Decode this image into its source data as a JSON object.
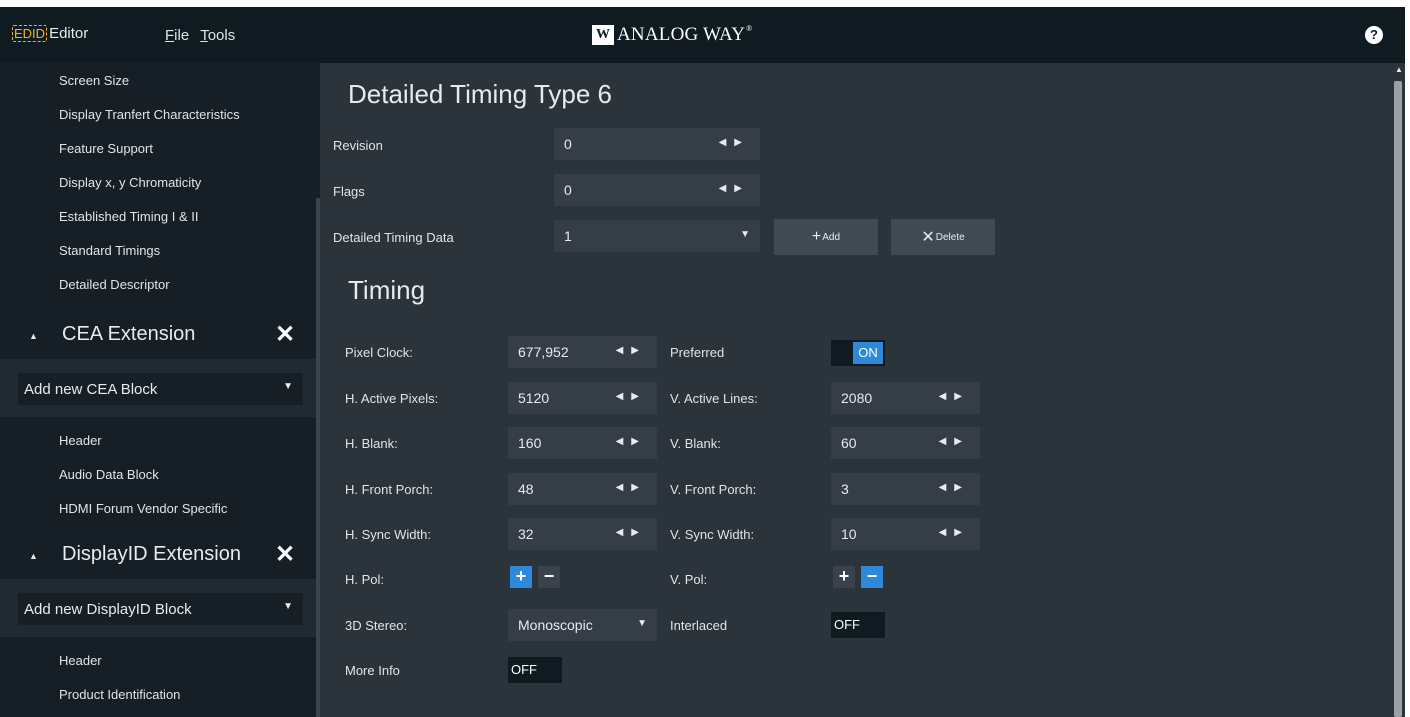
{
  "app": {
    "logo_chip": "EDID",
    "logo_text": "Editor",
    "menu": [
      "File",
      "Tools"
    ],
    "brand_mark": "W",
    "brand_name": "ANALOG WAY",
    "brand_reg": "®",
    "help_icon_label": "?"
  },
  "sidebar": {
    "items_top": [
      "Screen Size",
      "Display Tranfert Characteristics",
      "Feature Support",
      "Display x, y Chromaticity",
      "Established Timing I & II",
      "Standard Timings",
      "Detailed Descriptor"
    ],
    "cea": {
      "title": "CEA Extension",
      "add_label": "Add new CEA Block",
      "items": [
        "Header",
        "Audio Data Block",
        "HDMI Forum Vendor Specific"
      ]
    },
    "displayid": {
      "title": "DisplayID Extension",
      "add_label": "Add new DisplayID Block",
      "items": [
        "Header",
        "Product Identification"
      ]
    }
  },
  "main": {
    "title": "Detailed Timing Type 6",
    "revision": {
      "label": "Revision",
      "value": "0"
    },
    "flags": {
      "label": "Flags",
      "value": "0"
    },
    "timing_data": {
      "label": "Detailed Timing Data",
      "value": "1"
    },
    "add_button": "Add",
    "delete_button": "Delete",
    "timing_title": "Timing",
    "fields": {
      "pixel_clock": {
        "label": "Pixel Clock:",
        "value": "677,952"
      },
      "preferred": {
        "label": "Preferred",
        "state": "ON"
      },
      "h_active": {
        "label": "H. Active Pixels:",
        "value": "5120"
      },
      "v_active": {
        "label": "V. Active Lines:",
        "value": "2080"
      },
      "h_blank": {
        "label": "H. Blank:",
        "value": "160"
      },
      "v_blank": {
        "label": "V. Blank:",
        "value": "60"
      },
      "h_front": {
        "label": "H. Front Porch:",
        "value": "48"
      },
      "v_front": {
        "label": "V. Front Porch:",
        "value": "3"
      },
      "h_sync": {
        "label": "H. Sync Width:",
        "value": "32"
      },
      "v_sync": {
        "label": "V. Sync Width:",
        "value": "10"
      },
      "h_pol": {
        "label": "H. Pol:",
        "selected": "+"
      },
      "v_pol": {
        "label": "V. Pol:",
        "selected": "-"
      },
      "stereo": {
        "label": "3D Stereo:",
        "value": "Monoscopic"
      },
      "interlaced": {
        "label": "Interlaced",
        "state": "OFF"
      },
      "more_info": {
        "label": "More Info",
        "state": "OFF"
      }
    }
  },
  "colors": {
    "accent": "#2e8ad8",
    "topbar": "#0f1a21",
    "sidebar": "#161f26",
    "panel": "#2b333b",
    "logo": "#f4b41a"
  }
}
